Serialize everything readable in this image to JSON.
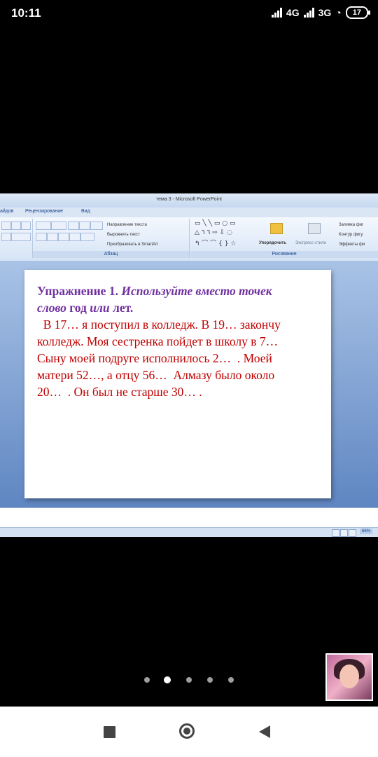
{
  "status_bar": {
    "time": "10:11",
    "network1": "4G",
    "network2": "3G",
    "battery": "17"
  },
  "window": {
    "title": "тема 3 - Microsoft PowerPoint",
    "tabs": [
      "айдов",
      "Рецензирование",
      "Вид"
    ]
  },
  "ribbon": {
    "paragraph": {
      "label": "Абзац",
      "text_direction": "Направление текста",
      "align_text": "Выровнять текст",
      "convert_smartart": "Преобразовать в SmartArt"
    },
    "drawing": {
      "label": "Рисование",
      "arrange": "Упорядочить",
      "quick_styles": "Экспресс-стили",
      "shape_fill": "Заливка фиг",
      "shape_outline": "Контур фигу",
      "shape_effects": "Эффекты фи"
    }
  },
  "slide": {
    "heading_part1": "Упражнение 1",
    "heading_part2": ". ",
    "heading_part3": "Используйте вместо точек",
    "heading_part4": "слово",
    "heading_part5": " год ",
    "heading_part6": "или",
    "heading_part7": " лет.",
    "lines": [
      "  В 17… я поступил в колледж. В 19… закончу",
      "колледж. Моя сестренка пойдет в школу в 7…",
      "Сыну моей подруге исполнилось 2…  . Моей",
      "матери 52…, а отцу 56…  Алмазу было около",
      "20…  . Он был не старше 30… ."
    ]
  },
  "status": {
    "zoom": "66%"
  },
  "pager": {
    "count": 5,
    "active_index": 1
  }
}
